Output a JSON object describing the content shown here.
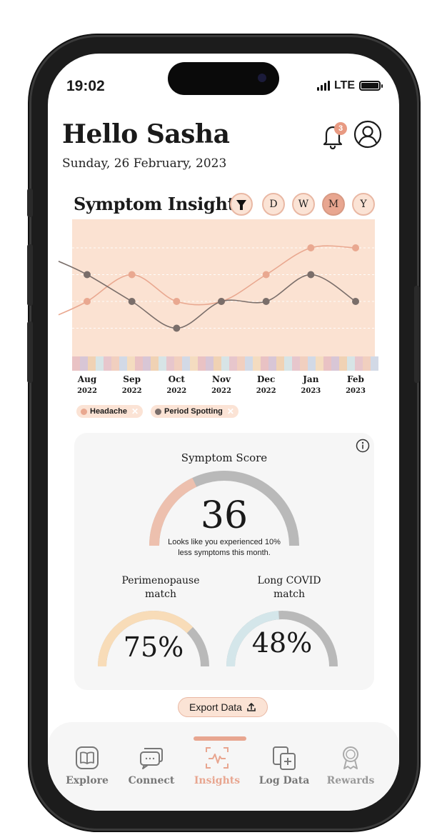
{
  "status": {
    "time": "19:02",
    "network": "LTE"
  },
  "header": {
    "greeting": "Hello Sasha",
    "date": "Sunday, 26 February, 2023",
    "notification_count": "3"
  },
  "insights": {
    "title": "Symptom Insights",
    "filters": [
      {
        "label": "D"
      },
      {
        "label": "W"
      },
      {
        "label": "M",
        "active": true
      },
      {
        "label": "Y"
      }
    ]
  },
  "chart_data": {
    "type": "line",
    "title": "",
    "x": [
      "Aug 2022",
      "Sep 2022",
      "Oct 2022",
      "Nov 2022",
      "Dec 2022",
      "Jan 2023",
      "Feb 2023"
    ],
    "x_ticks": [
      {
        "month": "Aug",
        "year": "2022"
      },
      {
        "month": "Sep",
        "year": "2022"
      },
      {
        "month": "Oct",
        "year": "2022"
      },
      {
        "month": "Nov",
        "year": "2022"
      },
      {
        "month": "Dec",
        "year": "2022"
      },
      {
        "month": "Jan",
        "year": "2023"
      },
      {
        "month": "Feb",
        "year": "2023"
      }
    ],
    "ylim": [
      0,
      5
    ],
    "grid": true,
    "series": [
      {
        "name": "Headache",
        "color": "#e9a890",
        "values": [
          2,
          3,
          2,
          2,
          3,
          4,
          4
        ]
      },
      {
        "name": "Period Spotting",
        "color": "#7a6e6a",
        "values": [
          3,
          2,
          1,
          2,
          2,
          3,
          2
        ]
      }
    ]
  },
  "legend": [
    {
      "label": "Headache",
      "color": "#e9a890"
    },
    {
      "label": "Period Spotting",
      "color": "#7a6e6a"
    }
  ],
  "score_card": {
    "title": "Symptom Score",
    "score": "36",
    "score_fraction": 0.36,
    "description_line1": "Looks like you experienced 10%",
    "description_line2": "less symptoms this month.",
    "gauges": [
      {
        "label_line1": "Perimenopause",
        "label_line2": "match",
        "value": "75%",
        "fraction": 0.75,
        "color": "#f8dcb8"
      },
      {
        "label_line1": "Long COVID",
        "label_line2": "match",
        "value": "48%",
        "fraction": 0.48,
        "color": "#d4e6ea"
      }
    ]
  },
  "export": {
    "label": "Export Data"
  },
  "tabs": [
    {
      "label": "Explore"
    },
    {
      "label": "Connect"
    },
    {
      "label": "Insights",
      "active": true
    },
    {
      "label": "Log Data"
    },
    {
      "label": "Rewards"
    }
  ],
  "colors": {
    "accent": "#e8a690",
    "chart_background": "#fbe2d2",
    "gauge_track": "#b9b9b9",
    "score_fill": "#edc0ae"
  }
}
